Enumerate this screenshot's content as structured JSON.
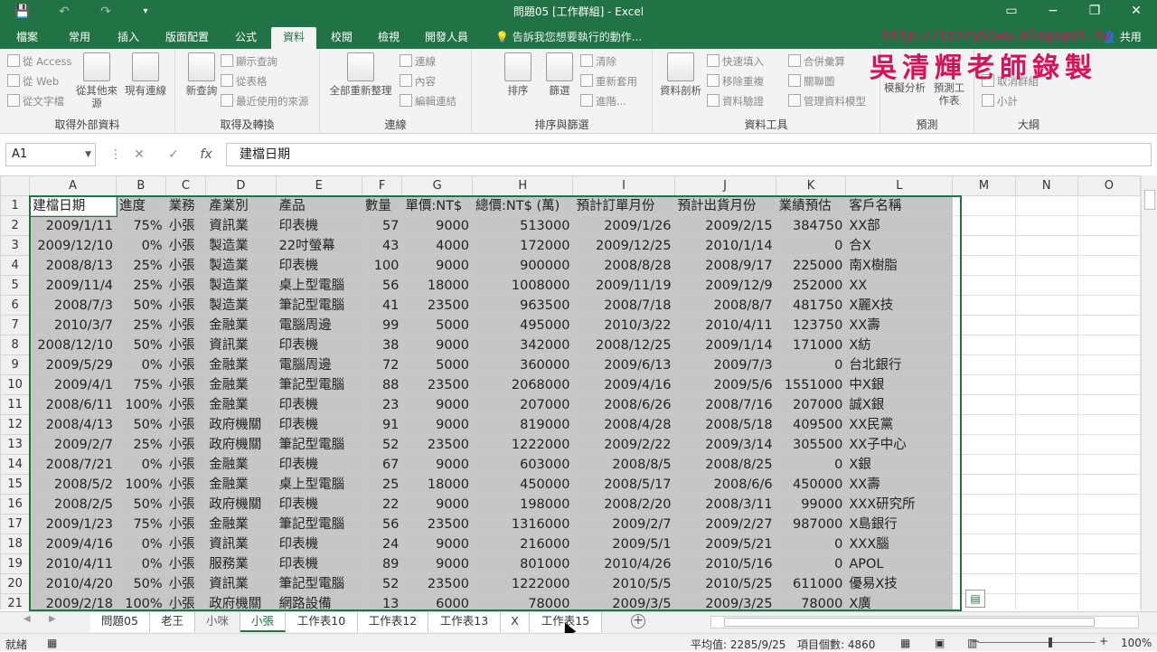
{
  "titlebar": {
    "title": "問題05 [工作群組] - Excel",
    "save_icon": "save-icon",
    "undo_icon": "undo-icon",
    "redo_icon": "redo-icon",
    "minimize": "−",
    "restore": "❐",
    "close": "✕",
    "ribbon_display": "▭"
  },
  "tabs": [
    "檔案",
    "常用",
    "插入",
    "版面配置",
    "公式",
    "資料",
    "校閱",
    "檢視",
    "開發人員"
  ],
  "active_tab": "資料",
  "tellme": "告訴我您想要執行的動作...",
  "share": "共用",
  "watermark": {
    "url": "http://terry55wu.blogspot.tw",
    "name": "吳清輝老師錄製"
  },
  "ribbon": {
    "get_external": {
      "label": "取得外部資料",
      "access": "從 Access",
      "web": "從 Web",
      "text": "從文字檔",
      "other": "從其他來源",
      "existing": "現有連線"
    },
    "transform": {
      "label": "取得及轉換",
      "new_query": "新查詢",
      "show_queries": "顯示查詢",
      "from_table": "從表格",
      "recent": "最近使用的來源"
    },
    "connections": {
      "label": "連線",
      "refresh_all": "全部重新整理",
      "conn": "連線",
      "props": "內容",
      "edit_links": "編輯連結"
    },
    "sort_filter": {
      "label": "排序與篩選",
      "sort": "排序",
      "filter": "篩選",
      "clear": "清除",
      "reapply": "重新套用",
      "advanced": "進階..."
    },
    "data_tools": {
      "label": "資料工具",
      "text_to_col": "資料剖析",
      "flash_fill": "快速填入",
      "remove_dup": "移除重複",
      "validation": "資料驗證",
      "consolidate": "合併彙算",
      "relationships": "關聯圖",
      "manage_model": "管理資料模型"
    },
    "forecast": {
      "label": "預測",
      "whatif": "模擬分析",
      "sheet": "預測工作表"
    },
    "outline": {
      "label": "大綱",
      "ungroup": "取消群組",
      "subtotal": "小計"
    }
  },
  "formula_bar": {
    "name_box": "A1",
    "cancel": "✕",
    "enter": "✓",
    "fx": "fx",
    "value": "建檔日期"
  },
  "columns": [
    "A",
    "B",
    "C",
    "D",
    "E",
    "F",
    "G",
    "H",
    "I",
    "J",
    "K",
    "L",
    "M",
    "N",
    "O"
  ],
  "headers": [
    "建檔日期",
    "進度",
    "業務",
    "產業別",
    "產品",
    "數量",
    "單價:NT$",
    "總價:NT$ (萬)",
    "預計訂單月份",
    "預計出貨月份",
    "業績預估",
    "客戶名稱"
  ],
  "rows": [
    [
      "2009/1/11",
      "75%",
      "小張",
      "資訊業",
      "印表機",
      "57",
      "9000",
      "513000",
      "2009/1/26",
      "2009/2/15",
      "384750",
      "XX部"
    ],
    [
      "2009/12/10",
      "0%",
      "小張",
      "製造業",
      "22吋螢幕",
      "43",
      "4000",
      "172000",
      "2009/12/25",
      "2010/1/14",
      "0",
      "合X"
    ],
    [
      "2008/8/13",
      "25%",
      "小張",
      "製造業",
      "印表機",
      "100",
      "9000",
      "900000",
      "2008/8/28",
      "2008/9/17",
      "225000",
      "南X樹脂"
    ],
    [
      "2009/11/4",
      "25%",
      "小張",
      "製造業",
      "桌上型電腦",
      "56",
      "18000",
      "1008000",
      "2009/11/19",
      "2009/12/9",
      "252000",
      "XX"
    ],
    [
      "2008/7/3",
      "50%",
      "小張",
      "製造業",
      "筆記型電腦",
      "41",
      "23500",
      "963500",
      "2008/7/18",
      "2008/8/7",
      "481750",
      "X麗X技"
    ],
    [
      "2010/3/7",
      "25%",
      "小張",
      "金融業",
      "電腦周邊",
      "99",
      "5000",
      "495000",
      "2010/3/22",
      "2010/4/11",
      "123750",
      "XX壽"
    ],
    [
      "2008/12/10",
      "50%",
      "小張",
      "資訊業",
      "印表機",
      "38",
      "9000",
      "342000",
      "2008/12/25",
      "2009/1/14",
      "171000",
      "X紡"
    ],
    [
      "2009/5/29",
      "0%",
      "小張",
      "金融業",
      "電腦周邊",
      "72",
      "5000",
      "360000",
      "2009/6/13",
      "2009/7/3",
      "0",
      "台北銀行"
    ],
    [
      "2009/4/1",
      "75%",
      "小張",
      "金融業",
      "筆記型電腦",
      "88",
      "23500",
      "2068000",
      "2009/4/16",
      "2009/5/6",
      "1551000",
      "中X銀"
    ],
    [
      "2008/6/11",
      "100%",
      "小張",
      "金融業",
      "印表機",
      "23",
      "9000",
      "207000",
      "2008/6/26",
      "2008/7/16",
      "207000",
      "誠X銀"
    ],
    [
      "2008/4/13",
      "50%",
      "小張",
      "政府機關",
      "印表機",
      "91",
      "9000",
      "819000",
      "2008/4/28",
      "2008/5/18",
      "409500",
      "XX民黨"
    ],
    [
      "2009/2/7",
      "25%",
      "小張",
      "政府機關",
      "筆記型電腦",
      "52",
      "23500",
      "1222000",
      "2009/2/22",
      "2009/3/14",
      "305500",
      "XX子中心"
    ],
    [
      "2008/7/21",
      "0%",
      "小張",
      "金融業",
      "印表機",
      "67",
      "9000",
      "603000",
      "2008/8/5",
      "2008/8/25",
      "0",
      "X銀"
    ],
    [
      "2008/5/2",
      "100%",
      "小張",
      "金融業",
      "桌上型電腦",
      "25",
      "18000",
      "450000",
      "2008/5/17",
      "2008/6/6",
      "450000",
      "XX壽"
    ],
    [
      "2008/2/5",
      "50%",
      "小張",
      "政府機關",
      "印表機",
      "22",
      "9000",
      "198000",
      "2008/2/20",
      "2008/3/11",
      "99000",
      "XXX研究所"
    ],
    [
      "2009/1/23",
      "75%",
      "小張",
      "金融業",
      "筆記型電腦",
      "56",
      "23500",
      "1316000",
      "2009/2/7",
      "2009/2/27",
      "987000",
      "X島銀行"
    ],
    [
      "2009/4/16",
      "0%",
      "小張",
      "資訊業",
      "印表機",
      "24",
      "9000",
      "216000",
      "2009/5/1",
      "2009/5/21",
      "0",
      "XXX腦"
    ],
    [
      "2010/4/11",
      "0%",
      "小張",
      "服務業",
      "印表機",
      "89",
      "9000",
      "801000",
      "2010/4/26",
      "2010/5/16",
      "0",
      "APOL"
    ],
    [
      "2010/4/20",
      "50%",
      "小張",
      "資訊業",
      "筆記型電腦",
      "52",
      "23500",
      "1222000",
      "2010/5/5",
      "2010/5/25",
      "611000",
      "優易X技"
    ],
    [
      "2009/2/18",
      "100%",
      "小張",
      "政府機關",
      "網路設備",
      "13",
      "6000",
      "78000",
      "2009/3/5",
      "2009/3/25",
      "78000",
      "X廣"
    ]
  ],
  "sheet_tabs": [
    "問題05",
    "老王",
    "小咪",
    "小張",
    "工作表10",
    "工作表12",
    "工作表13",
    "X",
    "工作表15"
  ],
  "active_sheet": "小張",
  "status": {
    "ready": "就緒",
    "average": "平均值: 2285/9/25",
    "count": "項目個數: 4860",
    "zoom": "100%"
  }
}
